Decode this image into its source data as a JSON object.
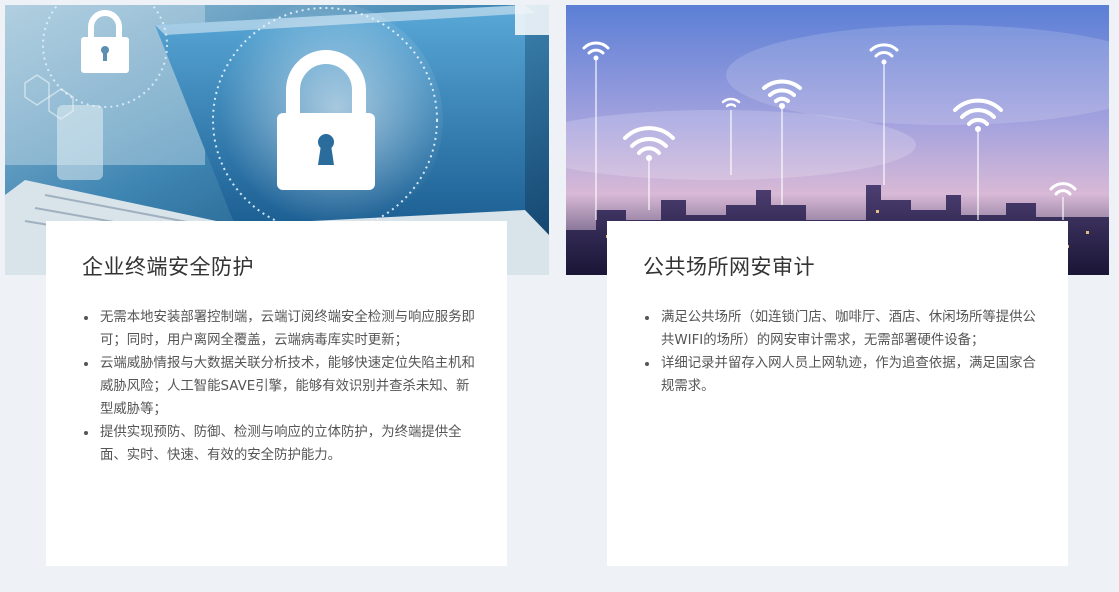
{
  "cards": [
    {
      "image": "laptop-padlock-security",
      "title": "企业终端安全防护",
      "bullets": [
        "无需本地安装部署控制端，云端订阅终端安全检测与响应服务即可；同时，用户离网全覆盖，云端病毒库实时更新；",
        "云端威胁情报与大数据关联分析技术，能够快速定位失陷主机和威胁风险；人工智能SAVE引擎，能够有效识别并查杀未知、新型威胁等；",
        "提供实现预防、防御、检测与响应的立体防护，为终端提供全面、实时、快速、有效的安全防护能力。"
      ]
    },
    {
      "image": "city-skyline-wifi-signals",
      "title": "公共场所网安审计",
      "bullets": [
        "满足公共场所（如连锁门店、咖啡厅、酒店、休闲场所等提供公共WIFI的场所）的网安审计需求，无需部署硬件设备；",
        "详细记录并留存入网人员上网轨迹，作为追查依据，满足国家合规需求。"
      ]
    }
  ],
  "colors": {
    "page_bg": "#eef1f6",
    "panel_bg": "#ffffff",
    "title": "#333333",
    "body_text": "#555555"
  }
}
